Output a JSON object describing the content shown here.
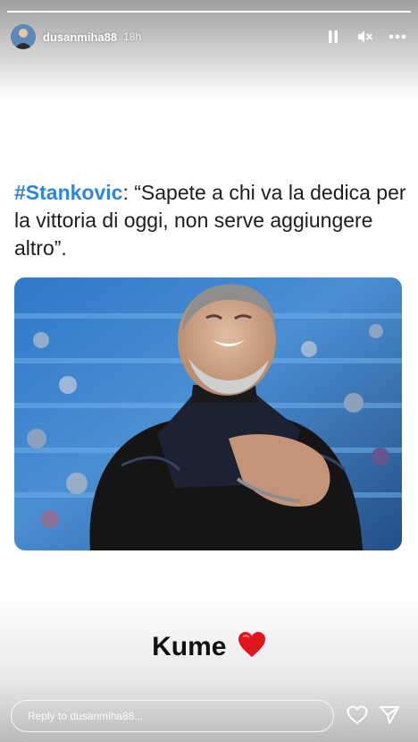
{
  "header": {
    "username": "dusanmiha88",
    "time": "18h",
    "icons": [
      "pause-icon",
      "mute-icon",
      "more-icon"
    ]
  },
  "post": {
    "hashtag": "#Stankovic",
    "quote": ": “Sapete a chi va la dedica per la vittoria di oggi, non serve aggiungere altro”.",
    "caption": "Kume"
  },
  "reply": {
    "placeholder": "Reply to dusanmiha88..."
  },
  "actions": [
    "like-icon",
    "send-icon"
  ],
  "colors": {
    "hashtag": "#2f86d8",
    "heart": "#e0151e",
    "text": "#1d1d1d"
  }
}
